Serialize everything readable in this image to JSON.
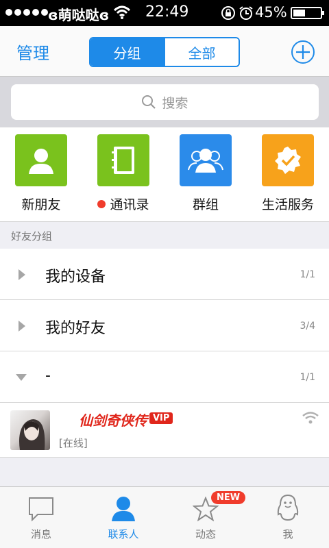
{
  "status_bar": {
    "carrier": "ɞ萌哒哒ɞ",
    "time": "22:49",
    "battery": "45%",
    "battery_level": 0.45
  },
  "nav": {
    "manage_label": "管理",
    "segments": [
      "分组",
      "全部"
    ]
  },
  "search": {
    "placeholder": "搜索"
  },
  "quick_entries": [
    {
      "label": "新朋友",
      "icon": "new-friend-icon",
      "color": "#7ac21d"
    },
    {
      "label": "通讯录",
      "icon": "address-book-icon",
      "color": "#7ac21d",
      "red_dot": true
    },
    {
      "label": "群组",
      "icon": "group-icon",
      "color": "#2b8bea"
    },
    {
      "label": "生活服务",
      "icon": "life-service-icon",
      "color": "#f7a21b"
    }
  ],
  "section_header": "好友分组",
  "groups": [
    {
      "name": "我的设备",
      "count": "1/1",
      "expanded": false
    },
    {
      "name": "我的好友",
      "count": "3/4",
      "expanded": false
    },
    {
      "name": "-",
      "count": "1/1",
      "expanded": true
    }
  ],
  "friend": {
    "name": "仙剑奇侠传",
    "vip": "VIP",
    "status": "[在线]"
  },
  "tabs": [
    {
      "label": "消息",
      "icon": "message-icon"
    },
    {
      "label": "联系人",
      "icon": "contacts-icon",
      "active": true
    },
    {
      "label": "动态",
      "icon": "star-icon"
    },
    {
      "label": "我",
      "icon": "penguin-icon"
    }
  ],
  "badge": "NEW",
  "colors": {
    "accent": "#1e8ae8",
    "green": "#7ac21d",
    "orange": "#f7a21b",
    "red": "#f03c2c"
  }
}
